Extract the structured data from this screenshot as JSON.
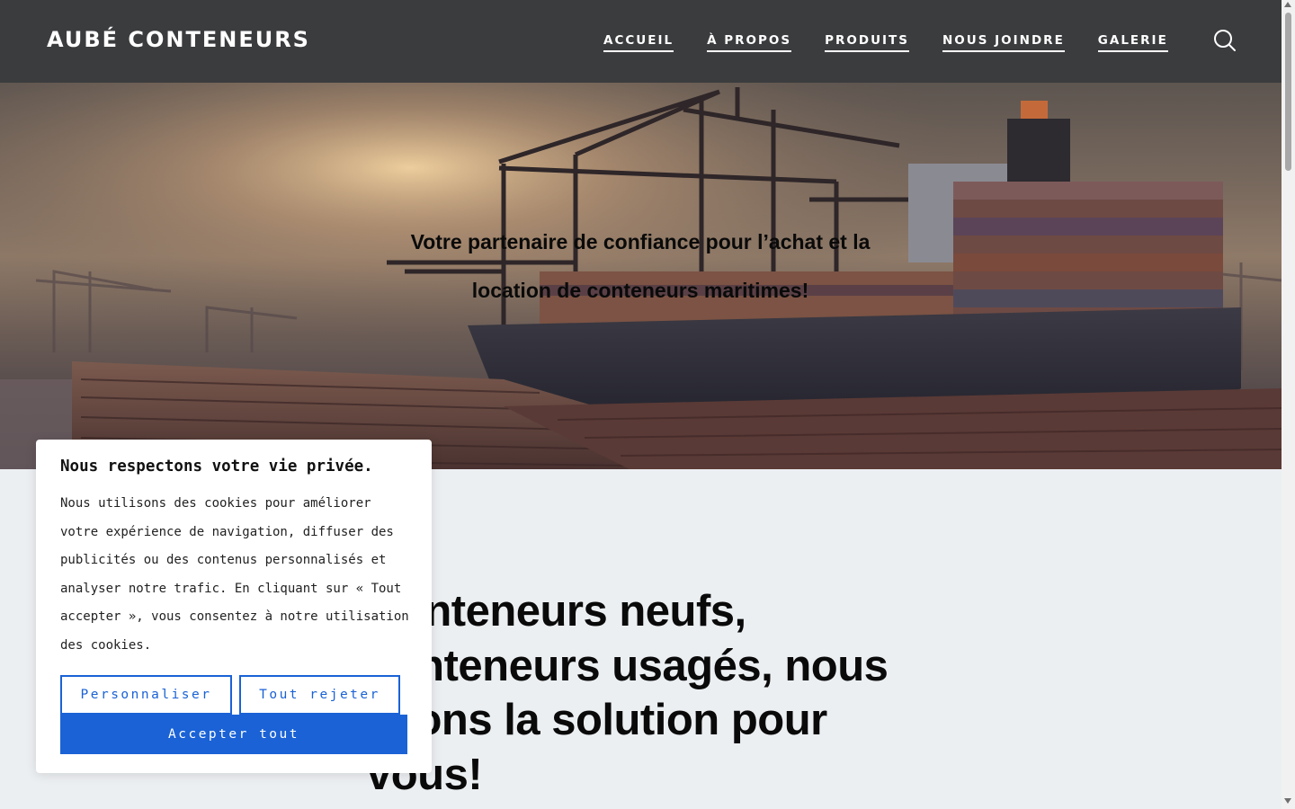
{
  "header": {
    "logo": "AUBÉ CONTENEURS",
    "nav": [
      {
        "label": "ACCUEIL"
      },
      {
        "label": "À PROPOS"
      },
      {
        "label": "PRODUITS"
      },
      {
        "label": "NOUS JOINDRE"
      },
      {
        "label": "GALERIE"
      }
    ],
    "search_icon": "search-icon",
    "background_color": "#3b3c3e"
  },
  "hero": {
    "tagline": "Votre partenaire de confiance pour l’achat et la location de conteneurs maritimes!",
    "image": "port-container-ship-sunset"
  },
  "main": {
    "heading": "Conteneurs neufs, conteneurs usagés, nous avons la solution pour vous!",
    "background_color": "#eceff2"
  },
  "cookie_banner": {
    "title": "Nous respectons votre vie privée.",
    "text": "Nous utilisons des cookies pour améliorer votre expérience de navigation, diffuser des publicités ou des contenus personnalisés et analyser notre trafic. En cliquant sur « Tout accepter », vous consentez à notre utilisation des cookies.",
    "customize_label": "Personnaliser",
    "reject_label": "Tout rejeter",
    "accept_label": "Accepter tout",
    "accent_color": "#1a62d6"
  }
}
